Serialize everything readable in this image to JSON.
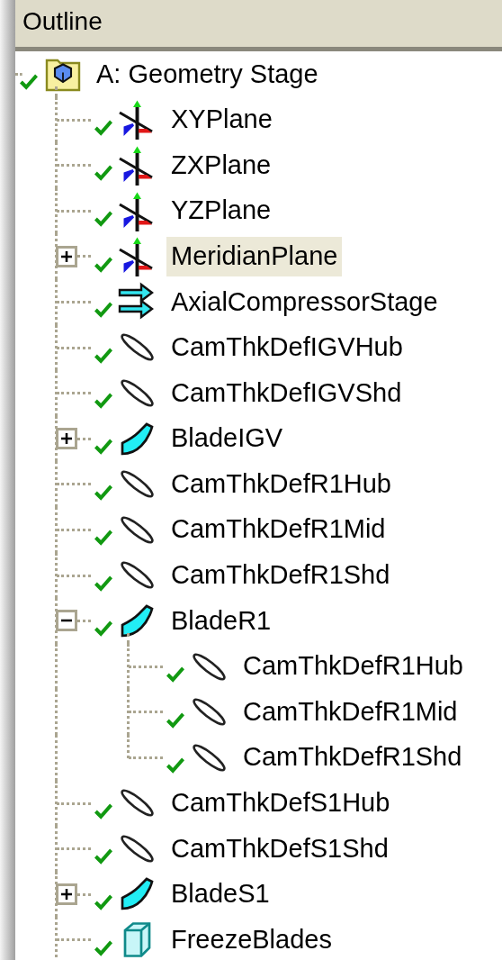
{
  "panel": {
    "title": "Outline"
  },
  "tree": [
    {
      "label": "A: Geometry Stage",
      "kind": "folder",
      "checked": true,
      "selected": false,
      "children": [
        {
          "label": "XYPlane",
          "kind": "plane",
          "checked": true,
          "selected": false
        },
        {
          "label": "ZXPlane",
          "kind": "plane",
          "checked": true,
          "selected": false
        },
        {
          "label": "YZPlane",
          "kind": "plane",
          "checked": true,
          "selected": false
        },
        {
          "label": "MeridianPlane",
          "kind": "plane",
          "checked": true,
          "selected": true,
          "expanded": false
        },
        {
          "label": "AxialCompressorStage",
          "kind": "stage",
          "checked": true,
          "selected": false
        },
        {
          "label": "CamThkDefIGVHub",
          "kind": "profile",
          "checked": true,
          "selected": false
        },
        {
          "label": "CamThkDefIGVShd",
          "kind": "profile",
          "checked": true,
          "selected": false
        },
        {
          "label": "BladeIGV",
          "kind": "blade",
          "checked": true,
          "selected": false,
          "expanded": false
        },
        {
          "label": "CamThkDefR1Hub",
          "kind": "profile",
          "checked": true,
          "selected": false
        },
        {
          "label": "CamThkDefR1Mid",
          "kind": "profile",
          "checked": true,
          "selected": false
        },
        {
          "label": "CamThkDefR1Shd",
          "kind": "profile",
          "checked": true,
          "selected": false
        },
        {
          "label": "BladeR1",
          "kind": "blade",
          "checked": true,
          "selected": false,
          "expanded": true,
          "children": [
            {
              "label": "CamThkDefR1Hub",
              "kind": "profile",
              "checked": true,
              "selected": false
            },
            {
              "label": "CamThkDefR1Mid",
              "kind": "profile",
              "checked": true,
              "selected": false
            },
            {
              "label": "CamThkDefR1Shd",
              "kind": "profile",
              "checked": true,
              "selected": false
            }
          ]
        },
        {
          "label": "CamThkDefS1Hub",
          "kind": "profile",
          "checked": true,
          "selected": false
        },
        {
          "label": "CamThkDefS1Shd",
          "kind": "profile",
          "checked": true,
          "selected": false
        },
        {
          "label": "BladeS1",
          "kind": "blade",
          "checked": true,
          "selected": false,
          "expanded": false
        },
        {
          "label": "FreezeBlades",
          "kind": "freeze",
          "checked": true,
          "selected": false
        }
      ]
    }
  ]
}
